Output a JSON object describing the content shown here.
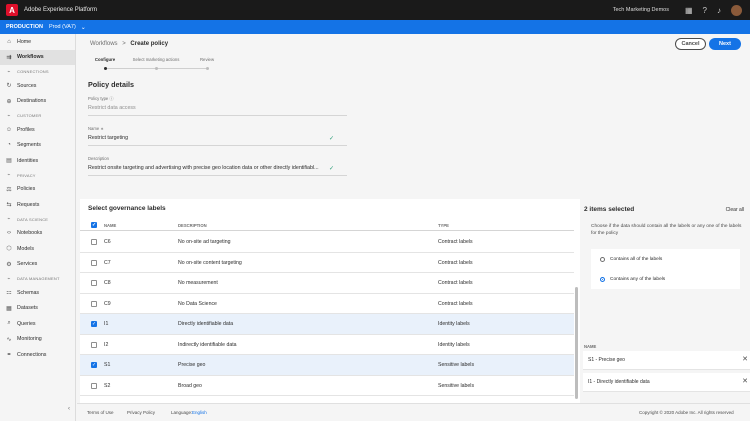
{
  "app": {
    "title": "Adobe Experience Platform",
    "org": "Tech Marketing Demos"
  },
  "env": {
    "name": "PRODUCTION",
    "sandbox": "Prod (VA7)"
  },
  "sidebar": {
    "items": [
      {
        "type": "item",
        "label": "Home",
        "icon": "⌂",
        "active": false
      },
      {
        "type": "item",
        "label": "Workflows",
        "icon": "⇉",
        "active": true
      },
      {
        "type": "section",
        "label": "CONNECTIONS",
        "icon": "⌁"
      },
      {
        "type": "item",
        "label": "Sources",
        "icon": "↻"
      },
      {
        "type": "item",
        "label": "Destinations",
        "icon": "⊕"
      },
      {
        "type": "section",
        "label": "CUSTOMER",
        "icon": "⌁"
      },
      {
        "type": "item",
        "label": "Profiles",
        "icon": "☺"
      },
      {
        "type": "item",
        "label": "Segments",
        "icon": "◔"
      },
      {
        "type": "item",
        "label": "Identities",
        "icon": "▤"
      },
      {
        "type": "section",
        "label": "PRIVACY",
        "icon": "⌁"
      },
      {
        "type": "item",
        "label": "Policies",
        "icon": "⚖"
      },
      {
        "type": "item",
        "label": "Requests",
        "icon": "⇆"
      },
      {
        "type": "section",
        "label": "DATA SCIENCE",
        "icon": "⌁"
      },
      {
        "type": "item",
        "label": "Notebooks",
        "icon": "‹›"
      },
      {
        "type": "item",
        "label": "Models",
        "icon": "⬡"
      },
      {
        "type": "item",
        "label": "Services",
        "icon": "⚙"
      },
      {
        "type": "section",
        "label": "DATA MANAGEMENT",
        "icon": "⌁"
      },
      {
        "type": "item",
        "label": "Schemas",
        "icon": "⚏"
      },
      {
        "type": "item",
        "label": "Datasets",
        "icon": "▦"
      },
      {
        "type": "item",
        "label": "Queries",
        "icon": "⌕"
      },
      {
        "type": "item",
        "label": "Monitoring",
        "icon": "∿"
      },
      {
        "type": "item",
        "label": "Connections",
        "icon": "⚭"
      }
    ]
  },
  "breadcrumb": {
    "parent": "Workflows",
    "sep": ">",
    "current": "Create policy"
  },
  "buttons": {
    "cancel": "Cancel",
    "next": "Next"
  },
  "steps": [
    {
      "label": "Configure",
      "current": true
    },
    {
      "label": "Select marketing actions",
      "current": false
    },
    {
      "label": "Review",
      "current": false
    }
  ],
  "policy": {
    "title": "Policy details",
    "type_label": "Policy type ⓘ",
    "type_value": "Restrict data access",
    "name_label": "Name ∗",
    "name_value": "Restrict targeting",
    "desc_label": "Description",
    "desc_value": "Restrict onsite targeting and advertising with precise geo location data or other directly identifiabl..."
  },
  "table": {
    "title": "Select governance labels",
    "headers": {
      "name": "NAME",
      "description": "DESCRIPTION",
      "type": "TYPE"
    },
    "rows": [
      {
        "name": "C6",
        "description": "No on-site ad targeting",
        "type": "Contract labels",
        "checked": false
      },
      {
        "name": "C7",
        "description": "No on-site content targeting",
        "type": "Contract labels",
        "checked": false
      },
      {
        "name": "C8",
        "description": "No measurement",
        "type": "Contract labels",
        "checked": false
      },
      {
        "name": "C9",
        "description": "No Data Science",
        "type": "Contract labels",
        "checked": false
      },
      {
        "name": "I1",
        "description": "Directly identifiable data",
        "type": "Identity labels",
        "checked": true
      },
      {
        "name": "I2",
        "description": "Indirectly identifiable data",
        "type": "Identity labels",
        "checked": false
      },
      {
        "name": "S1",
        "description": "Precise geo",
        "type": "Sensitive labels",
        "checked": true
      },
      {
        "name": "S2",
        "description": "Broad geo",
        "type": "Sensitive labels",
        "checked": false
      }
    ]
  },
  "selection": {
    "title": "2 items selected",
    "clear": "Clear all",
    "desc": "Choose if the data should contain all the labels or any one of the labels for the policy",
    "opt_all": "Contains all of the labels",
    "opt_any": "Contains any of the labels",
    "selected_option": "any",
    "name_header": "NAME",
    "items": [
      "S1 - Precise geo",
      "I1 - Directly identifiable data"
    ]
  },
  "footer": {
    "terms": "Terms of Use",
    "privacy": "Privacy Policy",
    "language_label": "Language:",
    "language": "English",
    "copyright": "Copyright © 2020 Adobe Inc. All rights reserved"
  },
  "colors": {
    "accent": "#1473e6",
    "topbar": "#1a1a1a",
    "adobe_red": "#e0102b",
    "check_green": "#2d9d78"
  }
}
